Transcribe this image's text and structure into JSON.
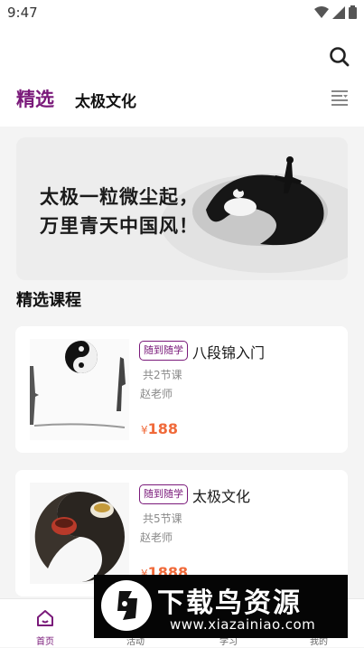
{
  "status_bar": {
    "time": "9:47"
  },
  "header": {
    "tabs": [
      {
        "label": "精选",
        "active": true
      },
      {
        "label": "太极文化",
        "active": false
      }
    ],
    "accent_color": "#7a1a7a"
  },
  "banner": {
    "line1": "太极一粒微尘起，",
    "line2": "万里青天中国风！"
  },
  "section": {
    "title": "精选课程"
  },
  "courses": [
    {
      "tag": "随到随学",
      "title": "八段锦入门",
      "lessons": "共2节课",
      "teacher": "赵老师",
      "currency": "¥",
      "price": "188"
    },
    {
      "tag": "随到随学",
      "title": "太极文化",
      "lessons": "共5节课",
      "teacher": "赵老师",
      "currency": "¥",
      "price": "1888"
    }
  ],
  "tabbar": {
    "items": [
      {
        "label": "首页",
        "icon": "home-icon",
        "active": true
      },
      {
        "label": "活动",
        "icon": "activity-icon",
        "active": false
      },
      {
        "label": "学习",
        "icon": "study-icon",
        "active": false
      },
      {
        "label": "我的",
        "icon": "profile-icon",
        "active": false
      }
    ]
  },
  "watermark": {
    "text": "下载鸟资源",
    "url": "www.xiazainiao.com"
  }
}
